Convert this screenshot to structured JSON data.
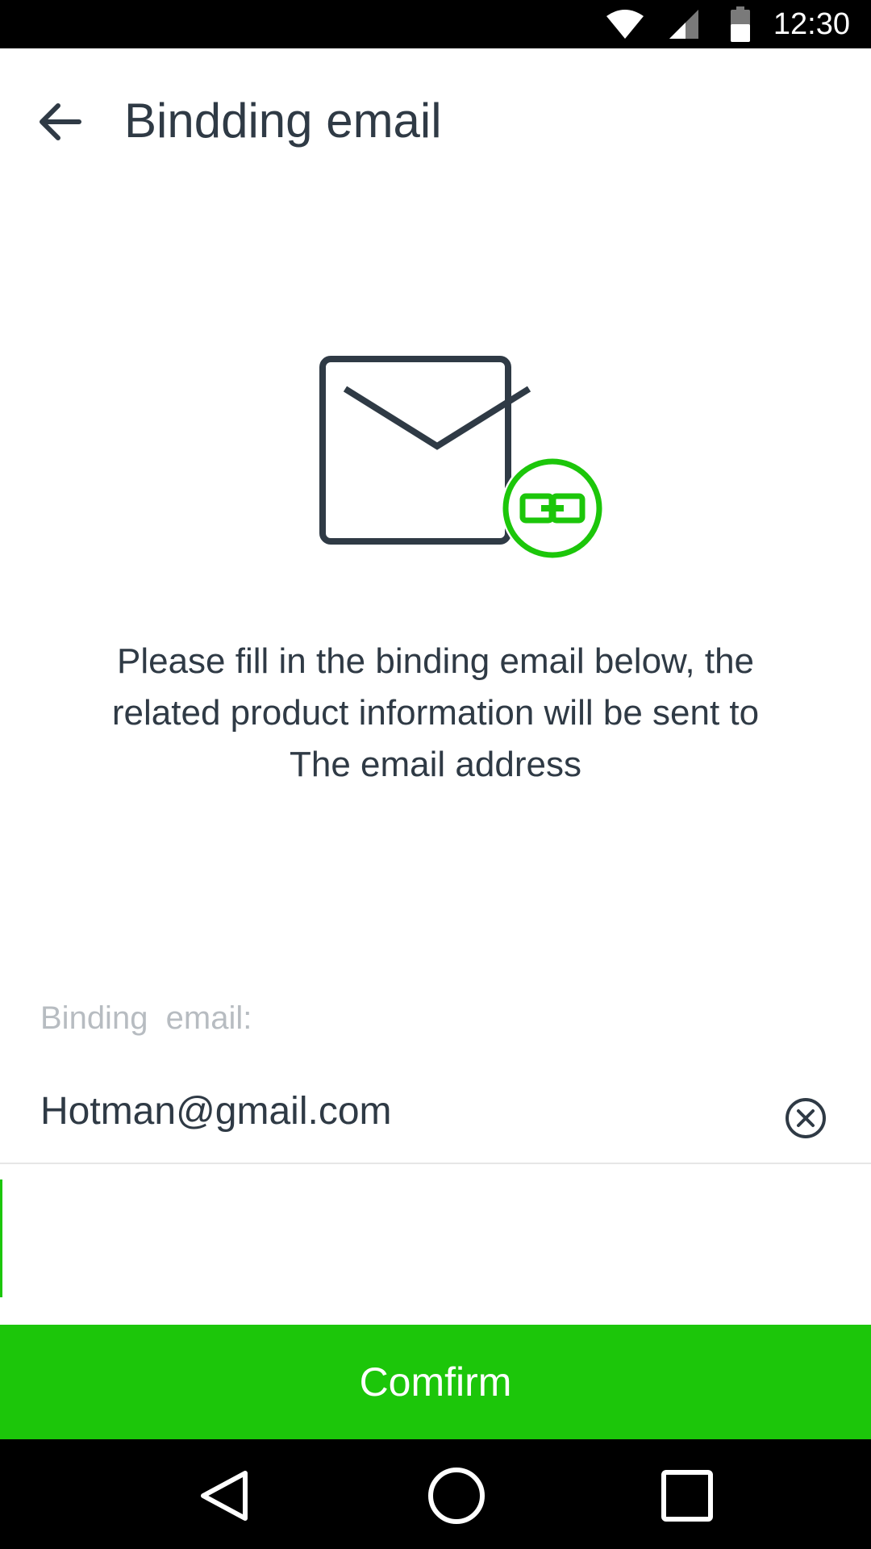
{
  "status_bar": {
    "time": "12:30",
    "icons": [
      "wifi-icon",
      "cellular-signal-icon",
      "battery-icon"
    ]
  },
  "app_bar": {
    "title": "Bindding email",
    "back_icon": "arrow-back-icon"
  },
  "hero": {
    "icons": [
      "envelope-icon",
      "link-icon"
    ]
  },
  "description": {
    "lines": [
      "Please fill in the binding email below, the",
      "related product information will be sent to",
      "The email address"
    ]
  },
  "form": {
    "label": "Binding  email:",
    "email_value": "Hotman@gmail.com",
    "clear_icon": "clear-circle-icon"
  },
  "confirm_button": {
    "label": "Comfirm"
  },
  "nav_bar": {
    "icons": [
      "nav-back-icon",
      "nav-home-icon",
      "nav-recents-icon"
    ]
  },
  "colors": {
    "accent": "#1cc60a",
    "text": "#2f3a45",
    "label": "#b7bcc1",
    "divider": "#e6e6e6"
  }
}
